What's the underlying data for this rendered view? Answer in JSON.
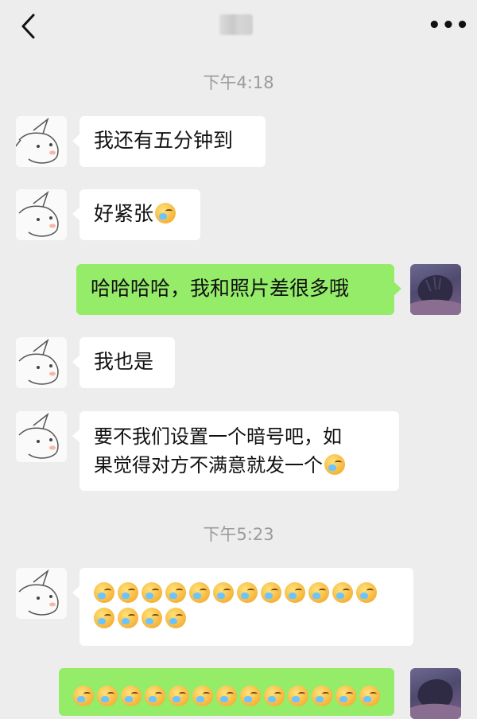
{
  "header": {
    "title": "",
    "more_label": "•••"
  },
  "icons": {
    "back": "chevron-left-icon",
    "more": "more-icon",
    "emoji": "facepalm-emoji"
  },
  "colors": {
    "background": "#ededed",
    "incoming_bubble": "#ffffff",
    "outgoing_bubble": "#95ec69"
  },
  "timestamps": [
    "下午4:18",
    "下午5:23"
  ],
  "messages": [
    {
      "from": "other",
      "text": "我还有五分钟到",
      "emoji_count": 0
    },
    {
      "from": "other",
      "text": "好紧张",
      "emoji_count": 1
    },
    {
      "from": "me",
      "text": "哈哈哈哈，我和照片差很多哦",
      "emoji_count": 0
    },
    {
      "from": "other",
      "text": "我也是",
      "emoji_count": 0
    },
    {
      "from": "other",
      "text": "要不我们设置一个暗号吧，如果觉得对方不满意就发一个",
      "line1": "要不我们设置一个暗号吧，如",
      "line2": "果觉得对方不满意就发一个",
      "emoji_count": 1
    },
    {
      "from": "other",
      "text": "",
      "emoji_count": 16
    },
    {
      "from": "me",
      "text": "",
      "emoji_count": 13
    }
  ]
}
